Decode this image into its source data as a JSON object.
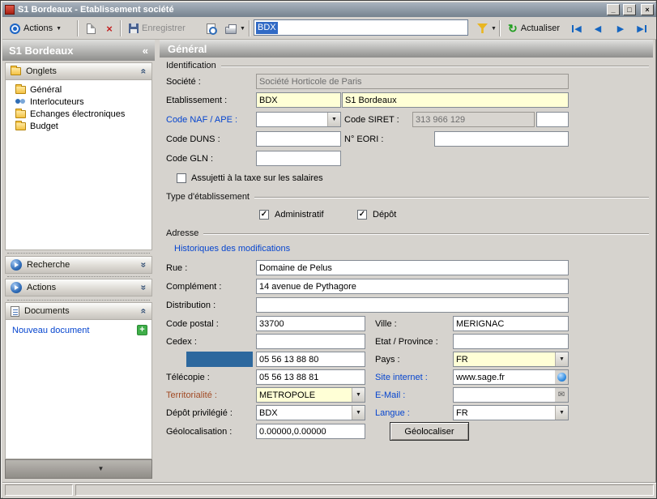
{
  "window": {
    "title": "S1 Bordeaux - Etablissement société"
  },
  "icons": {
    "minimize": "_",
    "maximize": "□",
    "close": "×",
    "dropdown": "▼",
    "delete": "×",
    "refresh": "↻",
    "nav_first": "◀",
    "nav_prev": "◀",
    "nav_next": "▶",
    "nav_last": "▶",
    "collapse": "«",
    "chevron_up": "«",
    "chevron_down": "»",
    "check": "✓",
    "plus": "+",
    "mail": "✉",
    "panel_arrow": "▼"
  },
  "toolbar": {
    "actions_label": "Actions",
    "save_label": "Enregistrer",
    "reference_value": "BDX",
    "refresh_label": "Actualiser"
  },
  "sidebar": {
    "title": "S1 Bordeaux",
    "sections": {
      "onglets": "Onglets",
      "recherche": "Recherche",
      "actions": "Actions",
      "documents": "Documents"
    },
    "tree": [
      {
        "label": "Général"
      },
      {
        "label": "Interlocuteurs"
      },
      {
        "label": "Echanges électroniques"
      },
      {
        "label": "Budget"
      }
    ],
    "nouveau_document": "Nouveau document"
  },
  "main": {
    "header": "Général",
    "identification": {
      "caption": "Identification",
      "societe_label": "Société :",
      "societe_value": "Société Horticole de Paris",
      "etablissement_label": "Etablissement :",
      "etablissement_code": "BDX",
      "etablissement_nom": "S1 Bordeaux",
      "naf_label": "Code NAF / APE :",
      "siret_label": "Code SIRET :",
      "siret_value": "313 966 129",
      "duns_label": "Code DUNS :",
      "eori_label": "N° EORI :",
      "gln_label": "Code GLN :",
      "taxe_label": "Assujetti à la taxe sur les salaires"
    },
    "type_etablissement": {
      "caption": "Type d'établissement",
      "administratif_label": "Administratif",
      "depot_label": "Dépôt"
    },
    "adresse": {
      "caption": "Adresse",
      "historique_link": "Historiques des modifications",
      "rue_label": "Rue :",
      "rue_value": "Domaine de Pelus",
      "complement_label": "Complément :",
      "complement_value": "14 avenue de Pythagore",
      "distribution_label": "Distribution :",
      "code_postal_label": "Code postal :",
      "code_postal_value": "33700",
      "cedex_label": "Cedex :",
      "telephone_value": "05 56 13 88 80",
      "telecopie_label": "Télécopie :",
      "telecopie_value": "05 56 13 88 81",
      "territorialite_label": "Territorialité :",
      "territorialite_value": "METROPOLE",
      "depot_privilegie_label": "Dépôt privilégié :",
      "depot_privilegie_value": "BDX",
      "geolocalisation_label": "Géolocalisation :",
      "geolocalisation_value": "0.00000,0.00000",
      "ville_label": "Ville :",
      "ville_value": "MERIGNAC",
      "etat_label": "Etat / Province :",
      "pays_label": "Pays :",
      "pays_value": "FR",
      "site_label": "Site internet :",
      "site_value": "www.sage.fr",
      "email_label": "E-Mail :",
      "langue_label": "Langue :",
      "langue_value": "FR",
      "geolocaliser_button": "Géolocaliser"
    }
  }
}
